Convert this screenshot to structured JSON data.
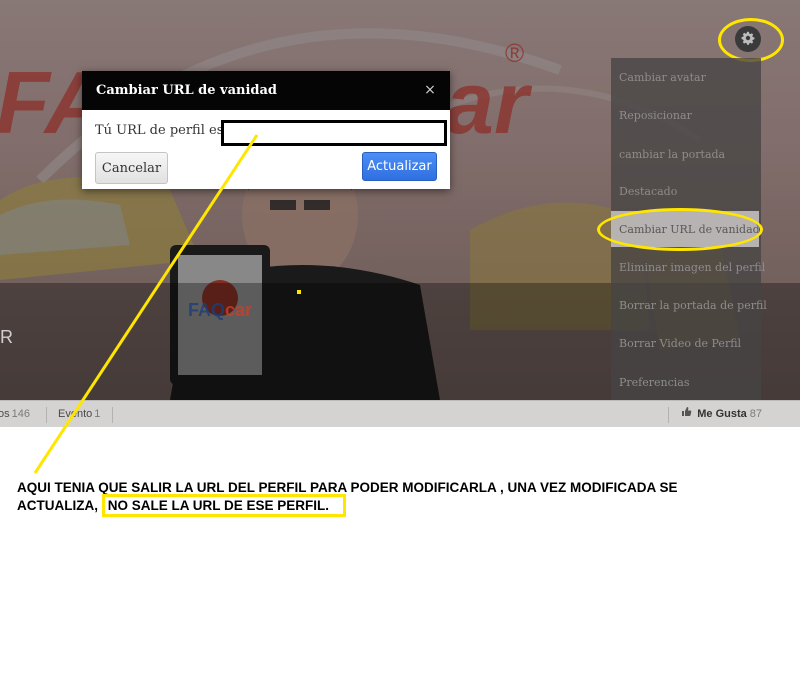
{
  "modal": {
    "title": "Cambiar URL de vanidad",
    "close_glyph": "×",
    "url_label": "Tú URL de perfil es",
    "url_value": "",
    "cancel_label": "Cancelar",
    "update_label": "Actualizar"
  },
  "settings_menu": {
    "items": [
      {
        "label": "Cambiar avatar"
      },
      {
        "label": "Reposicionar"
      },
      {
        "label": "cambiar la portada"
      },
      {
        "label": "Destacado"
      },
      {
        "label": "Cambiar URL de vanidad",
        "active": true
      },
      {
        "label": "Eliminar imagen del perfil"
      },
      {
        "label": "Borrar la portada de perfil"
      },
      {
        "label": "Borrar Video de Perfil"
      },
      {
        "label": "Preferencias"
      }
    ]
  },
  "cover": {
    "brand_text_large": "FAQ",
    "brand_text_large_2": "ar",
    "brand_registered": "®",
    "tablet_logo_top": "FAQ",
    "tablet_logo_bottom": "car",
    "profile_name_fragment": "R"
  },
  "stats_bar": {
    "first_tab_label": "os",
    "first_tab_count": "146",
    "second_tab_label": "Evento",
    "second_tab_count": "1",
    "likes_label": "Me Gusta",
    "likes_count": "87"
  },
  "icons": {
    "settings": "gear-icon",
    "close": "close-icon",
    "like": "thumbs-up-icon"
  },
  "colors": {
    "annotation_yellow": "#ffe600",
    "primary_button": "#3b7ff0",
    "modal_header": "#050505"
  },
  "annotation": {
    "line1": "AQUI TENIA QUE SALIR LA URL DEL PERFIL PARA PODER MODIFICARLA , UNA VEZ MODIFICADA SE",
    "line2_prefix": "ACTUALIZA,",
    "line2_highlight": "NO SALE LA URL DE ESE PERFIL."
  }
}
